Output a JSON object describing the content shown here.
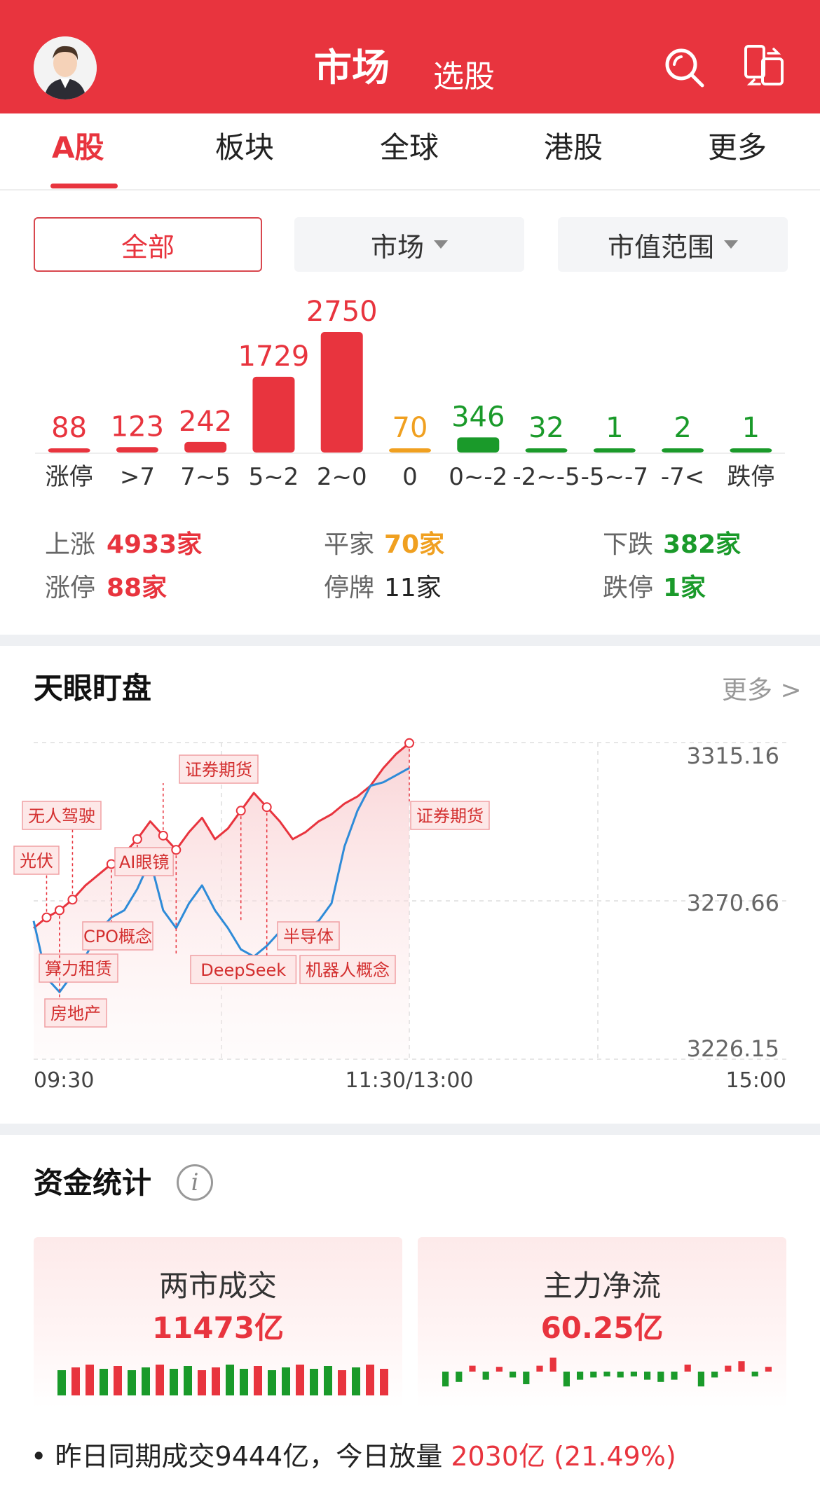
{
  "header": {
    "title": "市场",
    "subtitle": "选股",
    "icons": [
      "avatar",
      "search-icon",
      "switch-device-icon"
    ]
  },
  "tabs": [
    {
      "label": "A股",
      "active": true
    },
    {
      "label": "板块",
      "active": false
    },
    {
      "label": "全球",
      "active": false
    },
    {
      "label": "港股",
      "active": false
    },
    {
      "label": "更多",
      "active": false
    }
  ],
  "filters": {
    "all": "全部",
    "market": "市场",
    "cap": "市值范围"
  },
  "distribution": {
    "chart_data": {
      "type": "bar",
      "categories": [
        "涨停",
        ">7",
        "7~5",
        "5~2",
        "2~0",
        "0",
        "0~-2",
        "-2~-5",
        "-5~-7",
        "-7<",
        "跌停"
      ],
      "values": [
        88,
        123,
        242,
        1729,
        2750,
        70,
        346,
        32,
        1,
        2,
        1
      ],
      "colors": [
        "#e8343e",
        "#e8343e",
        "#e8343e",
        "#e8343e",
        "#e8343e",
        "#f0a020",
        "#1a9a2a",
        "#1a9a2a",
        "#1a9a2a",
        "#1a9a2a",
        "#1a9a2a"
      ],
      "ylim": [
        0,
        2750
      ]
    }
  },
  "stats": {
    "up_label": "上涨",
    "up_value": "4933家",
    "flat_label": "平家",
    "flat_value": "70家",
    "down_label": "下跌",
    "down_value": "382家",
    "limit_up_label": "涨停",
    "limit_up_value": "88家",
    "suspended_label": "停牌",
    "suspended_value": "11家",
    "limit_down_label": "跌停",
    "limit_down_value": "1家"
  },
  "tianyan": {
    "title": "天眼盯盘",
    "more": "更多 >",
    "chart_data": {
      "type": "line",
      "x_ticks": [
        "09:30",
        "11:30/13:00",
        "15:00"
      ],
      "y_ticks": [
        3315.16,
        3270.66,
        3226.15
      ],
      "ylim": [
        3226.15,
        3315.16
      ],
      "series": [
        {
          "color": "#e8343e",
          "values": [
            3263,
            3266,
            3268,
            3271,
            3275,
            3278,
            3281,
            3284,
            3288,
            3293,
            3289,
            3285,
            3290,
            3294,
            3288,
            3291,
            3296,
            3301,
            3297,
            3293,
            3288,
            3290,
            3293,
            3295,
            3298,
            3300,
            3303,
            3308,
            3312,
            3315
          ]
        },
        {
          "color": "#2e8bd8",
          "values": [
            3265,
            3249,
            3245,
            3250,
            3255,
            3262,
            3266,
            3268,
            3274,
            3282,
            3268,
            3263,
            3270,
            3275,
            3268,
            3263,
            3257,
            3255,
            3258,
            3262,
            3260,
            3263,
            3265,
            3270,
            3286,
            3296,
            3303,
            3304,
            3306,
            3308
          ]
        }
      ],
      "annotations": [
        "光伏",
        "无人驾驶",
        "算力租赁",
        "房地产",
        "CPO概念",
        "AI眼镜",
        "证券期货",
        "DeepSeek",
        "半导体",
        "机器人概念",
        "证券期货"
      ]
    }
  },
  "funds": {
    "title": "资金统计",
    "cards": [
      {
        "title": "两市成交",
        "value": "11473亿"
      },
      {
        "title": "主力净流",
        "value": "60.25亿"
      }
    ],
    "turnover_bars": [
      "#1a9a2a",
      "#e8343e",
      "#e8343e",
      "#1a9a2a",
      "#e8343e",
      "#1a9a2a",
      "#1a9a2a",
      "#e8343e",
      "#1a9a2a",
      "#1a9a2a",
      "#e8343e",
      "#e8343e",
      "#1a9a2a",
      "#1a9a2a",
      "#e8343e",
      "#1a9a2a",
      "#1a9a2a",
      "#e8343e",
      "#1a9a2a",
      "#1a9a2a",
      "#e8343e",
      "#1a9a2a",
      "#e8343e",
      "#e8343e"
    ],
    "flow_bars": [
      -12,
      -8,
      4,
      -6,
      3,
      -4,
      -10,
      4,
      16,
      -12,
      -6,
      -4,
      -3,
      -4,
      -3,
      -6,
      -8,
      -6,
      5,
      -12,
      -4,
      4,
      8,
      -3,
      3
    ]
  },
  "bottom": {
    "bullet": "•",
    "text": "昨日同期成交9444亿，今日放量",
    "highlight": "2030亿 (21.49%)"
  }
}
